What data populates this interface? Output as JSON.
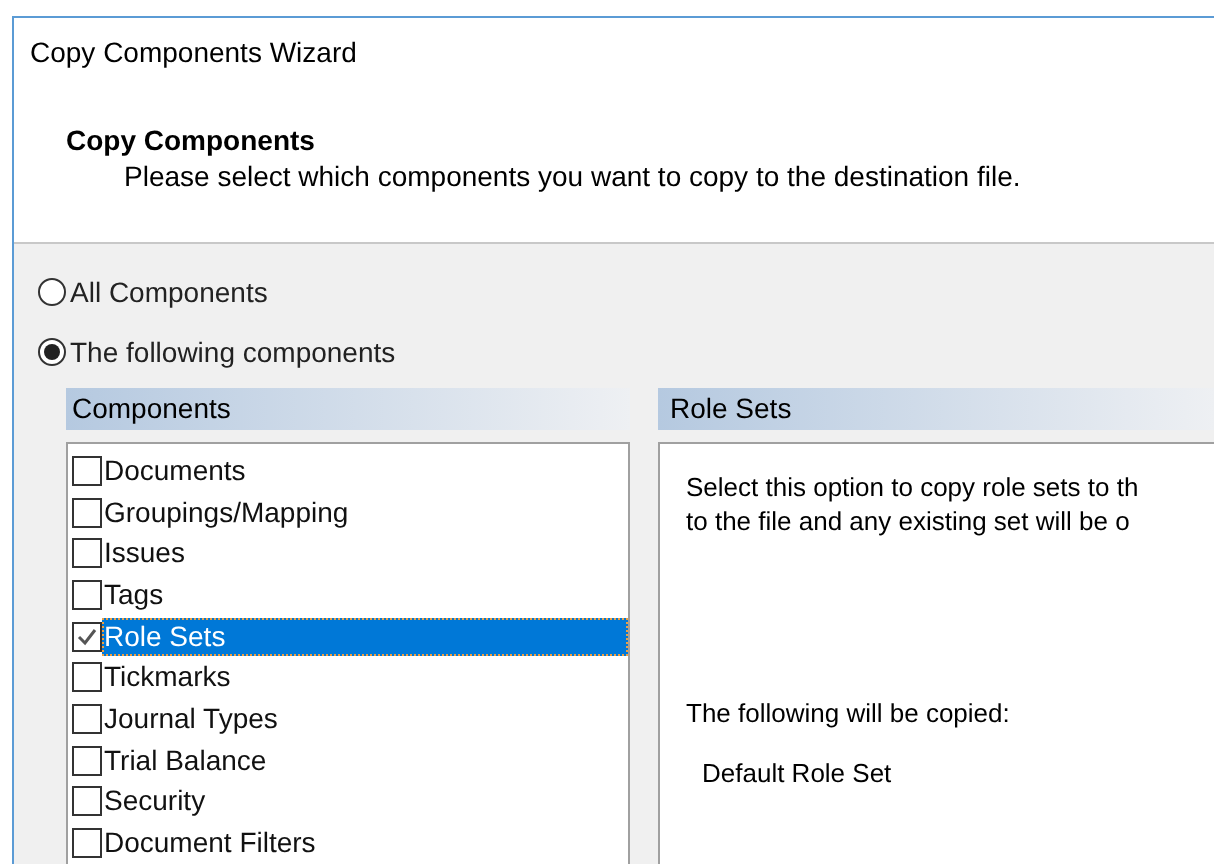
{
  "window": {
    "title": "Copy Components Wizard"
  },
  "header": {
    "title": "Copy Components",
    "subtitle": "Please select which components you want to copy to the destination file."
  },
  "options": [
    {
      "label": "All Components",
      "selected": false
    },
    {
      "label": "The following components",
      "selected": true
    }
  ],
  "components": {
    "heading": "Components",
    "items": [
      {
        "label": "Documents",
        "checked": false,
        "selected": false
      },
      {
        "label": "Groupings/Mapping",
        "checked": false,
        "selected": false
      },
      {
        "label": "Issues",
        "checked": false,
        "selected": false
      },
      {
        "label": "Tags",
        "checked": false,
        "selected": false
      },
      {
        "label": "Role Sets",
        "checked": true,
        "selected": true
      },
      {
        "label": "Tickmarks",
        "checked": false,
        "selected": false
      },
      {
        "label": "Journal Types",
        "checked": false,
        "selected": false
      },
      {
        "label": "Trial Balance",
        "checked": false,
        "selected": false
      },
      {
        "label": "Security",
        "checked": false,
        "selected": false
      },
      {
        "label": "Document Filters",
        "checked": false,
        "selected": false
      }
    ]
  },
  "details": {
    "heading": "Role Sets",
    "description": [
      "Select this option to copy role sets to th",
      "to the file and any existing set will be o"
    ],
    "copied_label": "The following will be copied:",
    "copied_items": [
      "Default Role Set"
    ]
  }
}
